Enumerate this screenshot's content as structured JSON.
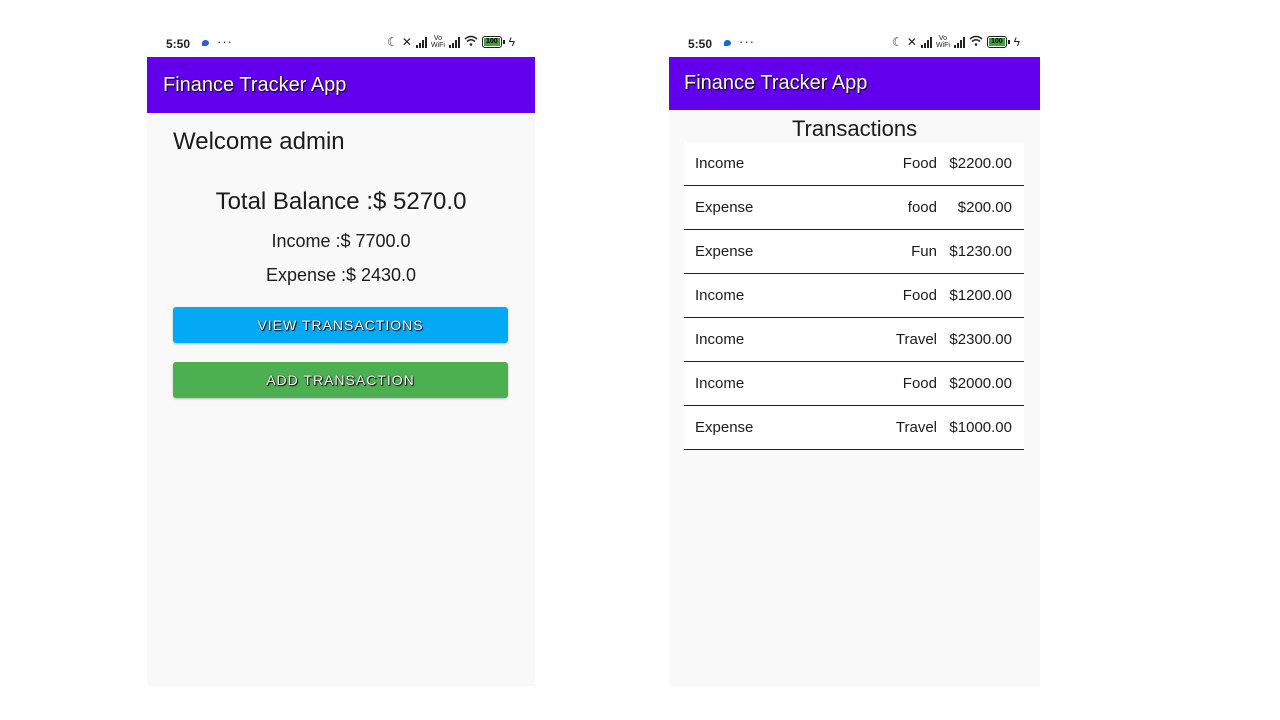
{
  "status_bar": {
    "time": "5:50",
    "more": "···",
    "battery": "100"
  },
  "app_title": "Finance Tracker App",
  "home": {
    "welcome": "Welcome admin",
    "total_balance": "Total Balance :$ 5270.0",
    "income": "Income :$ 7700.0",
    "expense": "Expense :$ 2430.0",
    "view_button": "VIEW TRANSACTIONS",
    "add_button": "ADD TRANSACTION",
    "colors": {
      "view_button": "#03a9f4",
      "add_button": "#4caf50",
      "app_bar": "#6200ee"
    }
  },
  "transactions": {
    "title": "Transactions",
    "rows": [
      {
        "type": "Income",
        "category": "Food",
        "amount": "$2200.00"
      },
      {
        "type": "Expense",
        "category": "food",
        "amount": "$200.00"
      },
      {
        "type": "Expense",
        "category": "Fun",
        "amount": "$1230.00"
      },
      {
        "type": "Income",
        "category": "Food",
        "amount": "$1200.00"
      },
      {
        "type": "Income",
        "category": "Travel",
        "amount": "$2300.00"
      },
      {
        "type": "Income",
        "category": "Food",
        "amount": "$2000.00"
      },
      {
        "type": "Expense",
        "category": "Travel",
        "amount": "$1000.00"
      }
    ]
  }
}
